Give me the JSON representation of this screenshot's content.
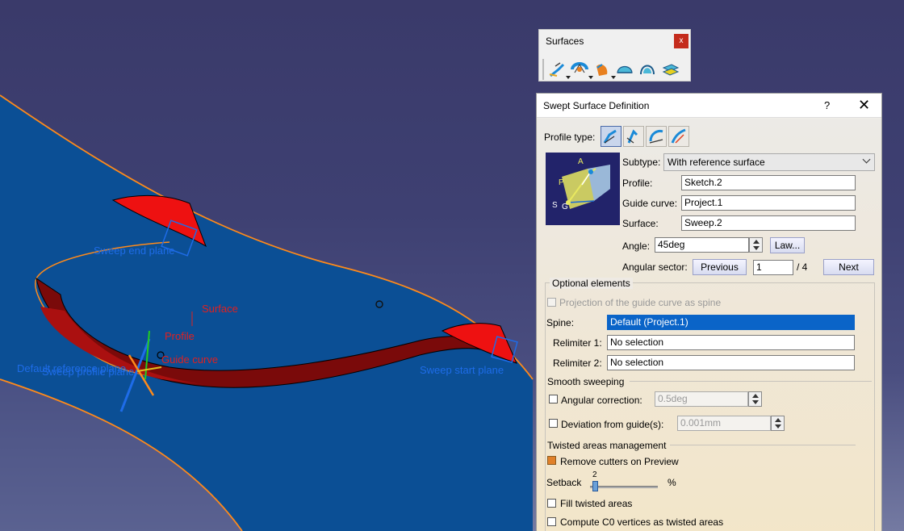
{
  "viewport": {
    "labels": {
      "sweep_end_plane": "Sweep end plane",
      "surface": "Surface",
      "profile": "Profile",
      "guide_curve": "Guide curve",
      "default_reference_plane": "Default reference plane",
      "sweep_profile_plane": "Sweep profile plane",
      "sweep_start_plane": "Sweep start plane"
    },
    "colors": {
      "background": "#3c3d6e",
      "surface": "#0b4f95",
      "edge": "#ff8a1a",
      "red_surface": "#ee1111",
      "label_blue": "#1e6ce8",
      "label_red": "#e02020"
    }
  },
  "surfaces_toolbar": {
    "title": "Surfaces",
    "close_label": "x",
    "icons": [
      "extrude-icon",
      "revolve-icon",
      "sweep-icon",
      "fill-icon",
      "blend-icon",
      "offset-icon"
    ]
  },
  "dialog": {
    "title": "Swept Surface Definition",
    "help_label": "?",
    "close_label": "✕",
    "profile_type_label": "Profile type:",
    "subtype_label": "Subtype:",
    "subtype_value": "With reference surface",
    "profile_label": "Profile:",
    "profile_value": "Sketch.2",
    "guide_curve_label": "Guide curve:",
    "guide_curve_value": "Project.1",
    "surface_label": "Surface:",
    "surface_value": "Sweep.2",
    "angle_label": "Angle:",
    "angle_value": "45deg",
    "law_button": "Law...",
    "angular_sector_label": "Angular sector:",
    "previous_button": "Previous",
    "sector_value": "1",
    "sector_total": "/ 4",
    "next_button": "Next",
    "preview_letters": {
      "a": "A",
      "p": "P",
      "s": "S",
      "g": "G"
    },
    "optional": {
      "title": "Optional elements",
      "projection_label": "Projection of the guide curve as spine",
      "spine_label": "Spine:",
      "spine_value": "Default (Project.1)",
      "relimiter1_label": "Relimiter 1:",
      "relimiter1_value": "No selection",
      "relimiter2_label": "Relimiter 2:",
      "relimiter2_value": "No selection"
    },
    "smooth": {
      "title": "Smooth sweeping",
      "angular_correction_label": "Angular correction:",
      "angular_correction_value": "0.5deg",
      "deviation_label": "Deviation from guide(s):",
      "deviation_value": "0.001mm"
    },
    "twisted": {
      "title": "Twisted areas management",
      "remove_cutters_label": "Remove cutters on Preview",
      "remove_cutters_checked": true,
      "setback_label": "Setback",
      "setback_value": "2",
      "setback_unit": "%",
      "fill_twisted_label": "Fill twisted areas",
      "compute_c0_label": "Compute C0 vertices as twisted areas"
    }
  }
}
